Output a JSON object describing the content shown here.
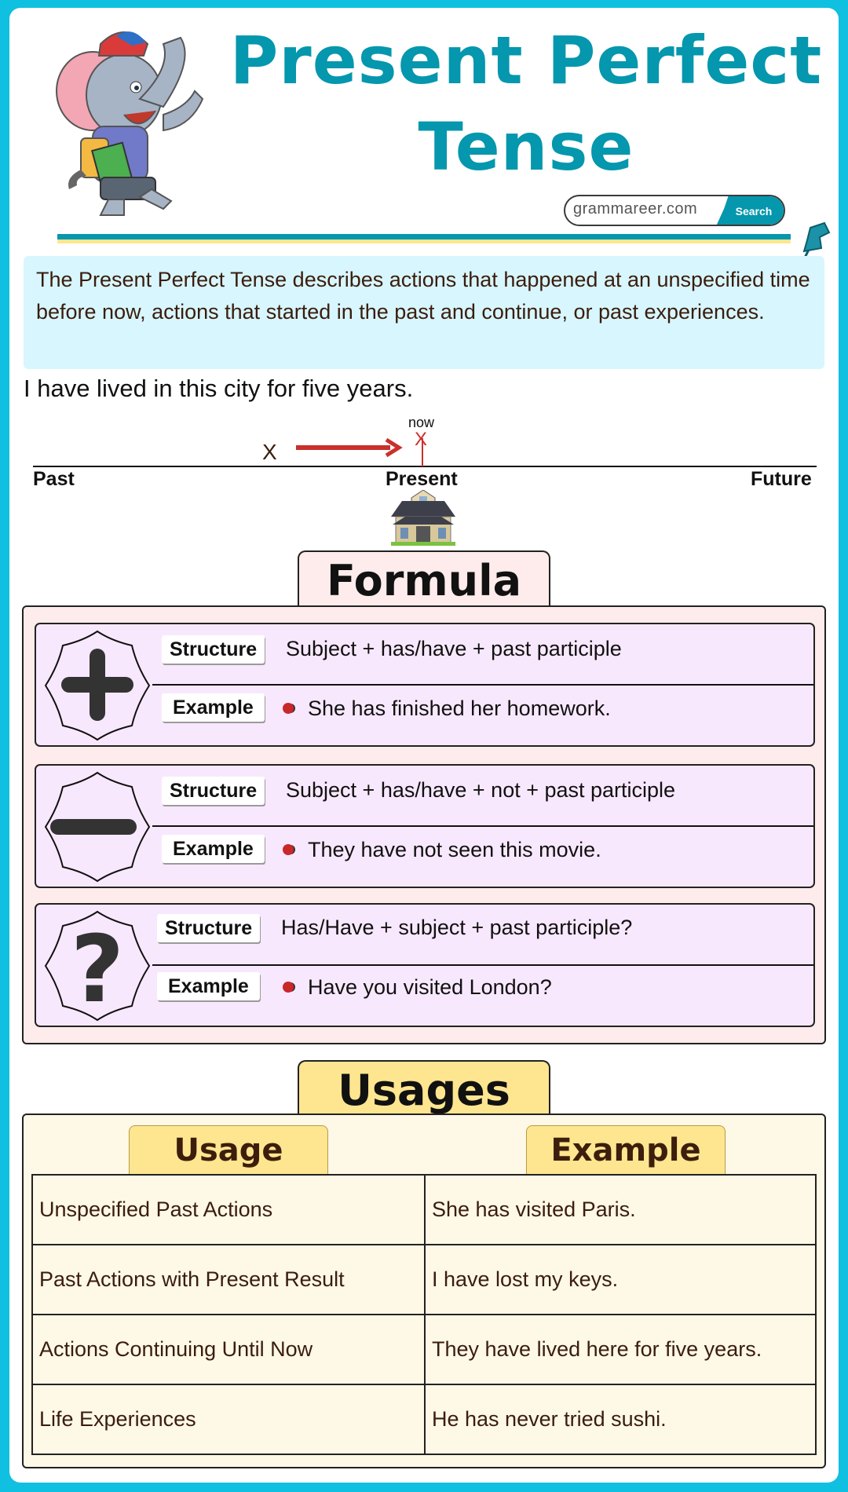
{
  "header": {
    "title_line1": "Present Perfect",
    "title_line2": "Tense",
    "search_value": "grammareer.com",
    "search_button": "Search",
    "mascot_icon": "elephant-mascot-icon",
    "pin_icon": "pushpin-icon"
  },
  "definition": "The Present Perfect Tense describes actions that happened at an unspecified time before now, actions that started in the past and continue, or past experiences.",
  "example_sentence": "I have lived in this city for five years.",
  "timeline": {
    "past": "Past",
    "present": "Present",
    "future": "Future",
    "now": "now",
    "start_mark": "X",
    "end_mark": "X",
    "icon": "house-icon",
    "arrow_color": "#c9302c"
  },
  "formula": {
    "title": "Formula",
    "cards": [
      {
        "type": "affirmative",
        "icon": "plus-icon",
        "structure_label": "Structure",
        "structure": "Subject + has/have + past participle",
        "example_label": "Example",
        "example": "She has finished her homework."
      },
      {
        "type": "negative",
        "icon": "minus-icon",
        "structure_label": "Structure",
        "structure": "Subject + has/have + not + past participle",
        "example_label": "Example",
        "example": "They have not seen this movie."
      },
      {
        "type": "interrogative",
        "icon": "question-mark-icon",
        "structure_label": "Structure",
        "structure": "Has/Have + subject + past participle?",
        "example_label": "Example",
        "example": "Have you visited London?"
      }
    ]
  },
  "usages": {
    "title": "Usages",
    "headers": [
      "Usage",
      "Example"
    ],
    "rows": [
      [
        "Unspecified Past Actions",
        "She has visited Paris."
      ],
      [
        "Past Actions with Present Result",
        "I have lost my keys."
      ],
      [
        "Actions Continuing Until Now",
        "They have lived here for five years."
      ],
      [
        "Life Experiences",
        "He has never tried sushi."
      ]
    ]
  },
  "colors": {
    "frame": "#10c0e0",
    "brand_teal": "#0497ad",
    "accent_yellow": "#fde68f",
    "definition_bg": "#d8f6fd",
    "formula_bg": "#fdeceb",
    "card_bg": "#f8e8fd",
    "usages_bg": "#fef8e7"
  }
}
